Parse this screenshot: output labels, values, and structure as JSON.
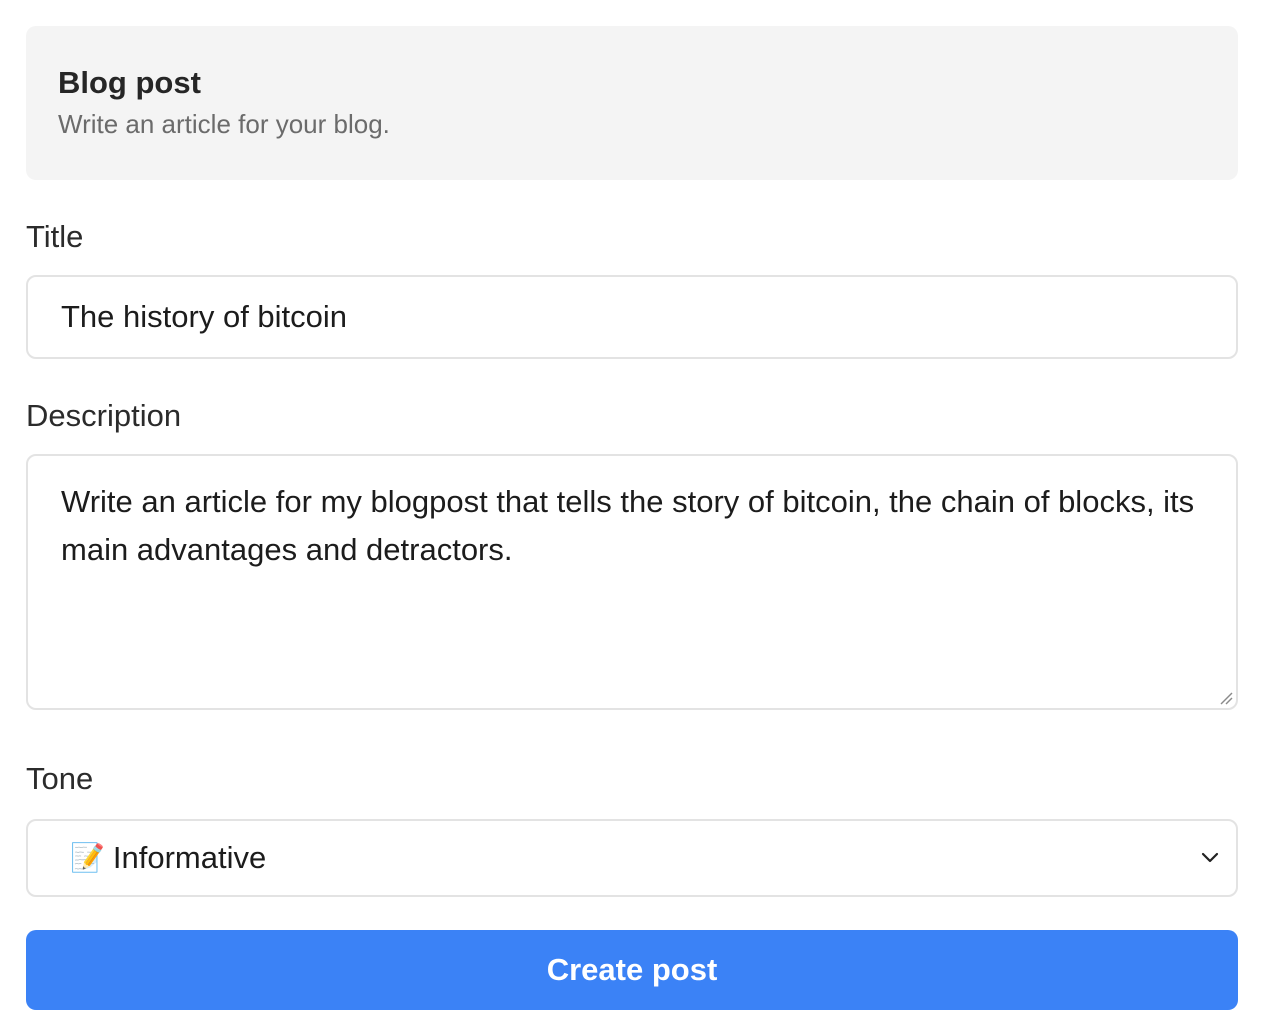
{
  "header": {
    "title": "Blog post",
    "subtitle": "Write an article for your blog."
  },
  "form": {
    "title_label": "Title",
    "title_value": "The history of bitcoin",
    "description_label": "Description",
    "description_value": "Write an article for my blogpost that tells the story of bitcoin, the chain of blocks, its main advantages and detractors.",
    "tone_label": "Tone",
    "tone_emoji": "📝",
    "tone_icon": "memo-icon",
    "tone_value": "Informative",
    "submit_label": "Create post"
  },
  "colors": {
    "primary_button": "#3b82f6",
    "header_background": "#f4f4f4",
    "input_border": "#e3e3e3"
  }
}
